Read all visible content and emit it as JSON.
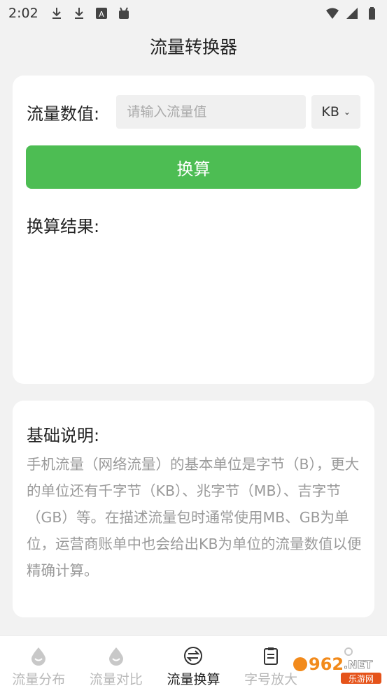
{
  "status_bar": {
    "time": "2:02",
    "left_icons": [
      "download-icon",
      "download-icon",
      "app-a-icon",
      "android-icon"
    ],
    "right_icons": [
      "wifi-icon",
      "signal-icon",
      "battery-icon"
    ]
  },
  "header": {
    "title": "流量转换器"
  },
  "converter": {
    "label": "流量数值:",
    "input": {
      "value": "",
      "placeholder": "请输入流量值"
    },
    "unit": {
      "selected": "KB"
    },
    "button_label": "换算",
    "result_label": "换算结果:"
  },
  "info": {
    "title": "基础说明:",
    "text": "手机流量（网络流量）的基本单位是字节（B），更大的单位还有千字节（KB）、兆字节（MB）、吉字节（GB）等。在描述流量包时通常使用MB、GB为单位，运营商账单中也会给出KB为单位的流量数值以便精确计算。"
  },
  "bottom_nav": {
    "items": [
      {
        "label": "流量分布",
        "icon": "drop-icon",
        "active": false
      },
      {
        "label": "流量对比",
        "icon": "drop-icon",
        "active": false
      },
      {
        "label": "流量换算",
        "icon": "exchange-icon",
        "active": true
      },
      {
        "label": "字号放大",
        "icon": "clipboard-icon",
        "active": false
      },
      {
        "label": "",
        "icon": "person-icon",
        "active": false
      }
    ]
  },
  "watermark": {
    "text": "962.NET 乐游网"
  },
  "colors": {
    "accent": "#4dbd53",
    "background": "#f2f2f2",
    "muted_text": "#9a9a9a"
  }
}
